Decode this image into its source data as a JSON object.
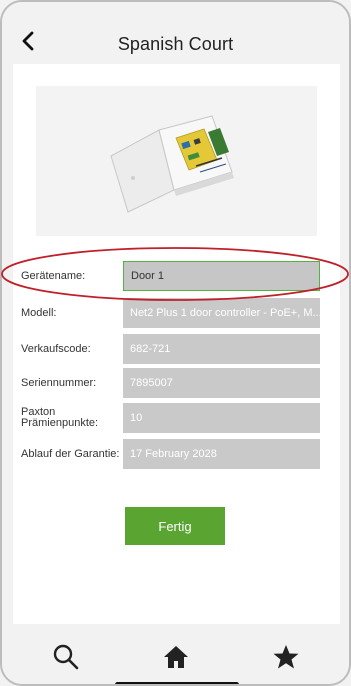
{
  "header": {
    "title": "Spanish Court",
    "back_icon": "chevron-left-icon"
  },
  "device": {
    "image_icon": "controller-box-image"
  },
  "form": {
    "rows": [
      {
        "label": "Gerätename:",
        "value": "Door 1"
      },
      {
        "label": "Modell:",
        "value": "Net2 Plus 1 door controller - PoE+, M..."
      },
      {
        "label": "Verkaufscode:",
        "value": "682-721"
      },
      {
        "label": "Seriennummer:",
        "value": "7895007"
      },
      {
        "label": "Paxton Prämienpunkte:",
        "value": "10"
      },
      {
        "label": "Ablauf der Garantie:",
        "value": "17 February 2028"
      }
    ]
  },
  "actions": {
    "done_label": "Fertig"
  },
  "tabbar": {
    "items": [
      {
        "icon": "search-icon"
      },
      {
        "icon": "home-icon"
      },
      {
        "icon": "star-icon"
      }
    ]
  },
  "colors": {
    "accent_green": "#5aa532",
    "field_gray": "#c9c9c9",
    "highlight_red": "#c0202a"
  }
}
